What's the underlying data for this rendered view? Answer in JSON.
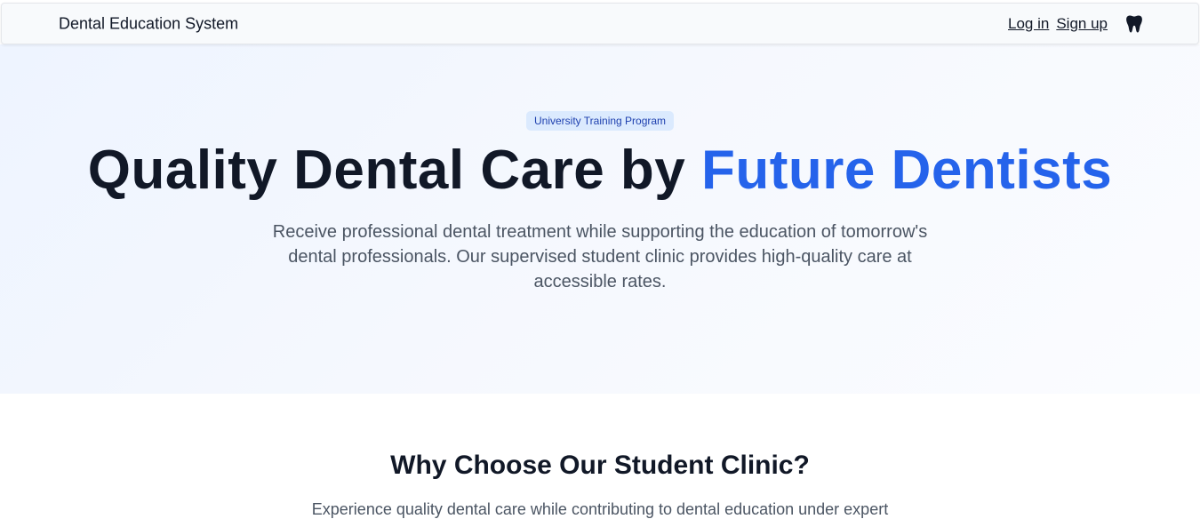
{
  "navbar": {
    "brand": "Dental Education System",
    "login_label": "Log in",
    "signup_label": "Sign up",
    "icon": "tooth-icon"
  },
  "hero": {
    "badge": "University Training Program",
    "title_main": "Quality Dental Care by ",
    "title_accent": "Future Dentists",
    "subtitle": "Receive professional dental treatment while supporting the education of tomorrow's dental professionals. Our supervised student clinic provides high-quality care at accessible rates."
  },
  "features": {
    "title": "Why Choose Our Student Clinic?",
    "subtitle": "Experience quality dental care while contributing to dental education under expert"
  },
  "colors": {
    "accent": "#2563eb",
    "badge_bg": "#dbeafe",
    "badge_text": "#1e40af",
    "heading": "#111827",
    "body_text": "#4b5563"
  }
}
